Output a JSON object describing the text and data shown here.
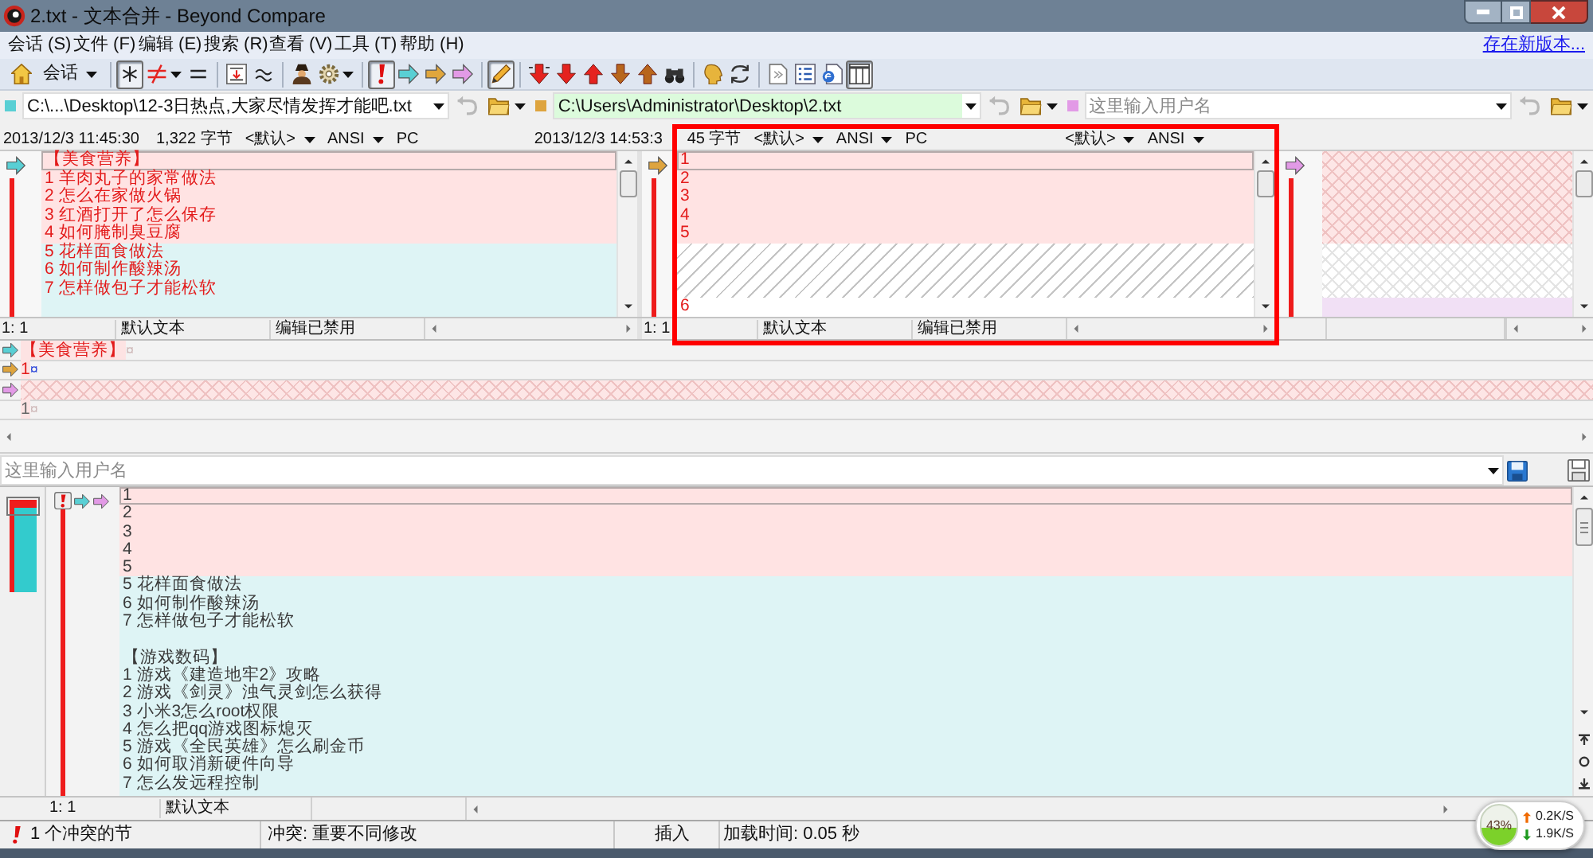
{
  "window": {
    "title": "2.txt - 文本合并 - Beyond Compare"
  },
  "menu": {
    "items": [
      "会话 (S)",
      "文件 (F)",
      "编辑 (E)",
      "搜索 (R)",
      "查看 (V)",
      "工具 (T)",
      "帮助 (H)"
    ],
    "update_link": "存在新版本..."
  },
  "toolbar": {
    "session_menu": "会话",
    "buttons": [
      {
        "pressed": false
      },
      {
        "pressed": true
      },
      {
        "pressed": false
      },
      {
        "pressed": false
      },
      {
        "pressed": false
      },
      {
        "pressed": false
      },
      {
        "pressed": false
      },
      {
        "pressed": false
      },
      {
        "pressed": true
      },
      {
        "pressed": false
      },
      {
        "pressed": false
      },
      {
        "pressed": false
      },
      {
        "pressed": true
      },
      {
        "pressed": false
      },
      {
        "pressed": false
      },
      {
        "pressed": false
      },
      {
        "pressed": false
      },
      {
        "pressed": false
      },
      {
        "pressed": false
      },
      {
        "pressed": false
      },
      {
        "pressed": false
      },
      {
        "pressed": false
      },
      {
        "pressed": false
      },
      {
        "pressed": false
      },
      {
        "pressed": true
      }
    ]
  },
  "panes": [
    {
      "color": "#59cfd4",
      "path": "C:\\...\\Desktop\\12-3日热点,大家尽情发挥才能吧.txt",
      "path_highlight": false,
      "info": {
        "modified": "2013/12/3 11:45:30",
        "size": "1,322 字节",
        "format": "<默认>",
        "encoding": "ANSI",
        "line_ending": "PC"
      },
      "conflict_text": true,
      "blocks": [
        {
          "kind": "conflict",
          "lines": [
            {
              "text": "【美食营养】",
              "selected": true
            },
            {
              "text": "1 羊肉丸子的家常做法",
              "selected": false
            },
            {
              "text": "2 怎么在家做火锅",
              "selected": false
            },
            {
              "text": "3 红酒打开了怎么保存",
              "selected": false
            },
            {
              "text": "4 如何腌制臭豆腐",
              "selected": false
            }
          ]
        },
        {
          "kind": "change",
          "lines": [
            {
              "text": "5 花样面食做法",
              "selected": false
            },
            {
              "text": "6 如何制作酸辣汤",
              "selected": false
            },
            {
              "text": "7 怎样做包子才能松软",
              "selected": false
            }
          ]
        }
      ],
      "status": {
        "position": "1: 1",
        "format": "默认文本",
        "edit": "编辑已禁用"
      }
    },
    {
      "color": "#dea43e",
      "path": "C:\\Users\\Administrator\\Desktop\\2.txt",
      "path_highlight": true,
      "info": {
        "modified": "2013/12/3 14:53:3",
        "size": "45 字节",
        "format": "<默认>",
        "encoding": "ANSI",
        "line_ending": "PC"
      },
      "conflict_text": true,
      "blocks": [
        {
          "kind": "conflict",
          "lines": [
            {
              "text": "1",
              "selected": true
            },
            {
              "text": "2",
              "selected": false
            },
            {
              "text": "3",
              "selected": false
            },
            {
              "text": "4",
              "selected": false
            },
            {
              "text": "5",
              "selected": false
            }
          ]
        },
        {
          "kind": "gap"
        },
        {
          "kind": "plain",
          "lines": [
            {
              "text": "6",
              "selected": false
            }
          ]
        }
      ],
      "status": {
        "position": "1: 1",
        "format": "默认文本",
        "edit": "编辑已禁用"
      }
    },
    {
      "color": "#e29ae6",
      "path_placeholder": "这里输入用户名",
      "path_highlight": false,
      "info": {
        "format": "<默认>",
        "encoding": "ANSI"
      },
      "blocks": [
        {
          "kind": "missing"
        },
        {
          "kind": "empty"
        },
        {
          "kind": "insert"
        }
      ]
    }
  ],
  "merge": {
    "rows": [
      {
        "kind": "left",
        "text": "【美食营养】",
        "end_mark": "¤"
      },
      {
        "kind": "middle",
        "text": "1",
        "end_mark": "¤"
      },
      {
        "kind": "right"
      },
      {
        "kind": "output",
        "text": "1",
        "end_mark": "¤"
      }
    ]
  },
  "output": {
    "path_placeholder": "这里输入用户名",
    "blocks": [
      {
        "kind": "conflict",
        "lines": [
          {
            "text": "1",
            "selected": true
          },
          {
            "text": "2",
            "selected": false
          },
          {
            "text": "3",
            "selected": false
          },
          {
            "text": "4",
            "selected": false
          },
          {
            "text": "5",
            "selected": false
          }
        ]
      },
      {
        "kind": "change",
        "lines": [
          {
            "text": "5 花样面食做法",
            "selected": false
          },
          {
            "text": "6 如何制作酸辣汤",
            "selected": false
          },
          {
            "text": "7 怎样做包子才能松软",
            "selected": false
          }
        ]
      },
      {
        "kind": "blank"
      },
      {
        "kind": "change",
        "lines": [
          {
            "text": "【游戏数码】",
            "selected": false
          },
          {
            "text": "1 游戏《建造地牢2》攻略",
            "selected": false
          },
          {
            "text": "2 游戏《剑灵》浊气灵剑怎么获得",
            "selected": false
          },
          {
            "text": "3 小米3怎么root权限",
            "selected": false
          },
          {
            "text": "4 怎么把qq游戏图标熄灭",
            "selected": false
          },
          {
            "text": "5 游戏《全民英雄》怎么刷金币",
            "selected": false
          },
          {
            "text": "6 如何取消新硬件向导",
            "selected": false
          },
          {
            "text": "7 怎么发远程控制",
            "selected": false
          }
        ]
      }
    ],
    "status": {
      "position": "1: 1",
      "format": "默认文本"
    }
  },
  "status_bar": {
    "conflicts": "1 个冲突的节",
    "conflict_type": "冲突: 重要不同修改",
    "mode": "插入",
    "load_time": "加载时间: 0.05 秒"
  },
  "network": {
    "percent": "43%",
    "level": 0.43,
    "upload": "0.2K/S",
    "download": "1.9K/S"
  }
}
